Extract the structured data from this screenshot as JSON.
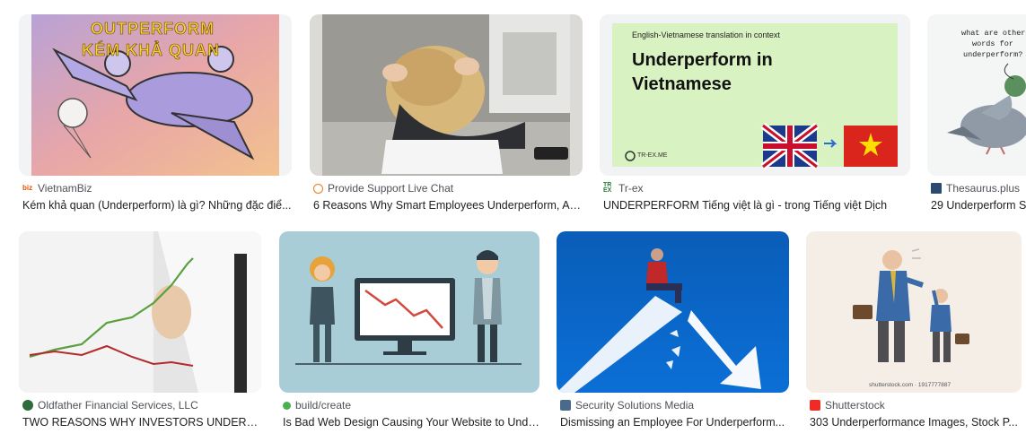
{
  "results": [
    {
      "source": "VietnamBiz",
      "favicon": "vietnambiz-icon",
      "title": "Kém khả quan (Underperform) là gì? Những đặc điể...",
      "image_text": [
        "OUTPERFORM",
        "KÉM KHẢ QUAN"
      ]
    },
    {
      "source": "Provide Support Live Chat",
      "favicon": "chat-bubble-icon",
      "title": "6 Reasons Why Smart Employees Underperform, An...",
      "image_text": []
    },
    {
      "source": "Tr-ex",
      "favicon": "trex-icon",
      "title": "UNDERPERFORM Tiếng việt là gì - trong Tiếng việt Dịch",
      "image_text": [
        "English-Vietnamese translation in context",
        "Underperform in",
        "Vietnamese",
        "TR-EX.ME"
      ]
    },
    {
      "source": "Thesaurus.plus",
      "favicon": "book-icon",
      "title": "29 Underperform S",
      "image_text": [
        "what are other",
        "words for",
        "underperform?"
      ]
    },
    {
      "source": "Oldfather Financial Services, LLC",
      "favicon": "oldfather-icon",
      "title": "TWO REASONS WHY INVESTORS UNDERPER...",
      "image_text": []
    },
    {
      "source": "build/create",
      "favicon": "green-dot-icon",
      "title": "Is Bad Web Design Causing Your Website to Unde...",
      "image_text": []
    },
    {
      "source": "Security Solutions Media",
      "favicon": "grid-icon",
      "title": "Dismissing an Employee For Underperform...",
      "image_text": []
    },
    {
      "source": "Shutterstock",
      "favicon": "shutterstock-icon",
      "title": "303 Underperformance Images, Stock P...",
      "image_text": [
        "shutterstock.com · 1917777887"
      ]
    }
  ],
  "colors": {
    "source_text": "#4d5156",
    "title_text": "#202124",
    "thumb_bg": "#f1f3f4"
  }
}
